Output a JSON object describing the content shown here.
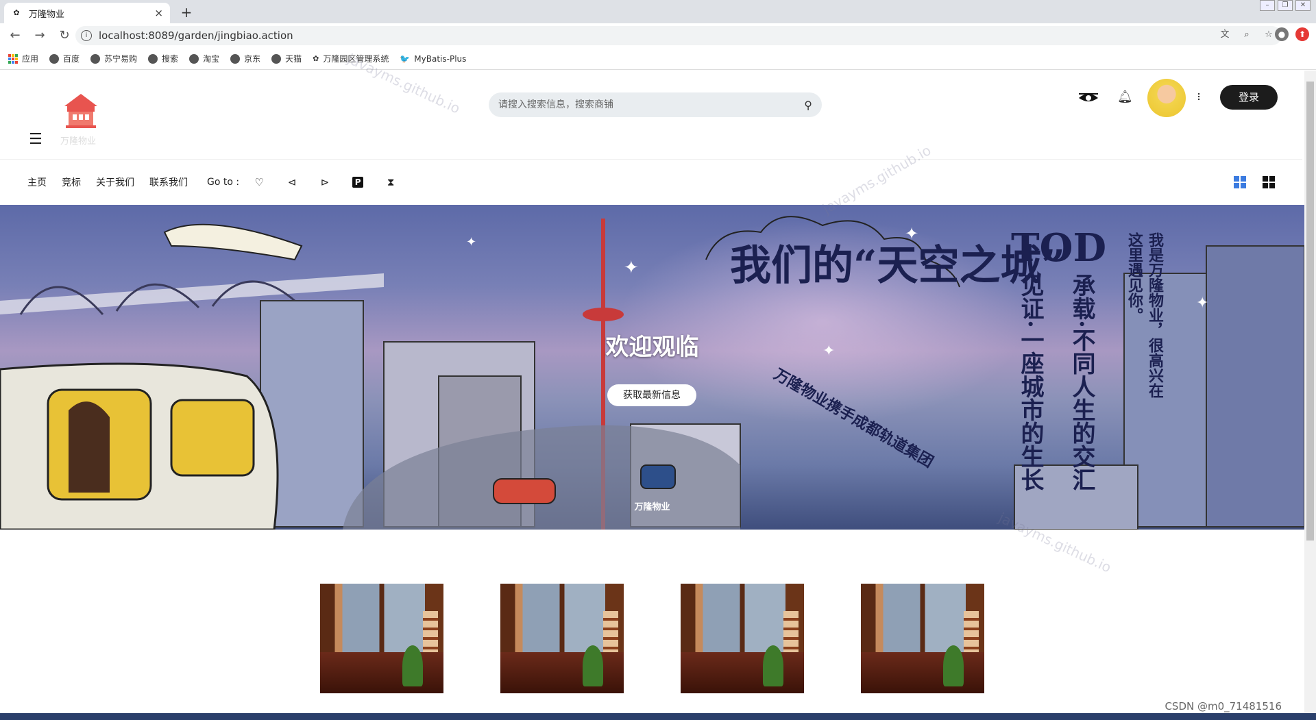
{
  "browser": {
    "tab_title": "万隆物业",
    "tab_close": "×",
    "new_tab": "+",
    "url": "localhost:8089/garden/jingbiao.action",
    "bookmarks": [
      {
        "label": "应用",
        "icon": "apps-icon"
      },
      {
        "label": "百度",
        "icon": "globe-icon"
      },
      {
        "label": "苏宁易购",
        "icon": "globe-icon"
      },
      {
        "label": "搜索",
        "icon": "globe-icon"
      },
      {
        "label": "淘宝",
        "icon": "globe-icon"
      },
      {
        "label": "京东",
        "icon": "globe-icon"
      },
      {
        "label": "天猫",
        "icon": "globe-icon"
      },
      {
        "label": "万隆园区管理系统",
        "icon": "leaf-icon"
      },
      {
        "label": "MyBatis-Plus",
        "icon": "bird-icon"
      }
    ]
  },
  "header": {
    "logo_text": "万隆物业",
    "search_placeholder": "请搜入搜索信息，搜索商铺",
    "login_label": "登录",
    "kebab": "⠇"
  },
  "nav": {
    "links": [
      "主页",
      "竞标",
      "关于我们",
      "联系我们"
    ],
    "goto_label": "Go to :",
    "icons": [
      "heart-icon",
      "back-circle-icon",
      "play-circle-icon",
      "parking-icon",
      "hourglass-icon"
    ]
  },
  "hero": {
    "title": "欢迎观临",
    "button_label": "获取最新信息",
    "caption": "万隆物业",
    "art_text": {
      "line1": "我们的“天空之城”",
      "tod": "TOD",
      "witness": "见证·一座城市的生长",
      "carry": "承载·不同人生的交汇",
      "intro": "我是万隆物业，很高兴在这里遇见你。",
      "arc": "万隆物业携手成都轨道集团"
    }
  },
  "cards": [
    {
      "alt": "shop-image-1"
    },
    {
      "alt": "shop-image-2"
    },
    {
      "alt": "shop-image-3"
    },
    {
      "alt": "shop-image-4"
    }
  ],
  "watermark": "javayms.github.io",
  "footer_credit": "CSDN @m0_71481516",
  "colors": {
    "login_bg": "#1c1c1c",
    "logo_red": "#e8544f",
    "grid_blue": "#3b7be0"
  }
}
